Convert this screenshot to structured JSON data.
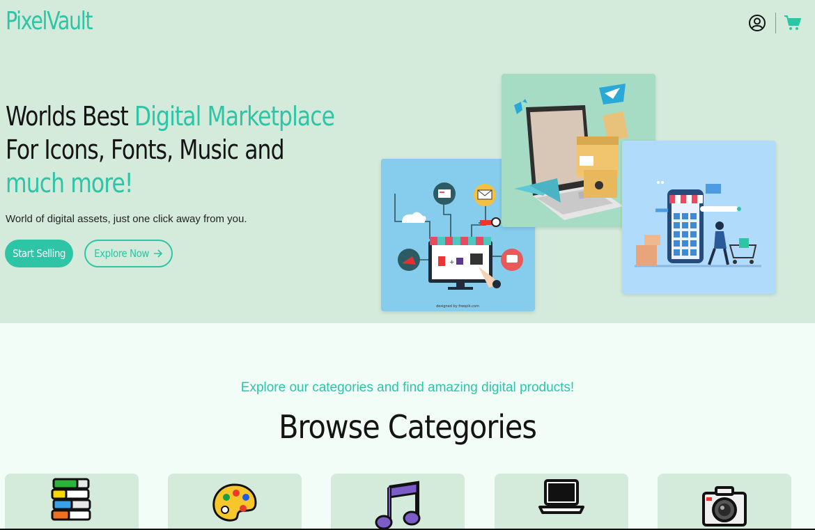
{
  "brand": {
    "name": "PixelVault",
    "accent_color": "#2ec4a6"
  },
  "header": {
    "icons": [
      "user-circle-icon",
      "shopping-cart-icon"
    ]
  },
  "hero": {
    "headline_part1": "Worlds Best ",
    "headline_accent1": "Digital Marketplace",
    "headline_part2": "For Icons, Fonts, Music and",
    "headline_accent2": "much more!",
    "subtext": "World of digital assets, just one click away from you.",
    "primary_button": "Start Selling",
    "secondary_button": "Explore Now",
    "image_credit": "designed by freepik.com"
  },
  "categories_section": {
    "tagline": "Explore our categories and find amazing digital products!",
    "title": "Browse Categories",
    "items": [
      {
        "icon": "books-icon"
      },
      {
        "icon": "palette-icon"
      },
      {
        "icon": "music-note-icon"
      },
      {
        "icon": "laptop-icon"
      },
      {
        "icon": "camera-icon"
      }
    ]
  }
}
